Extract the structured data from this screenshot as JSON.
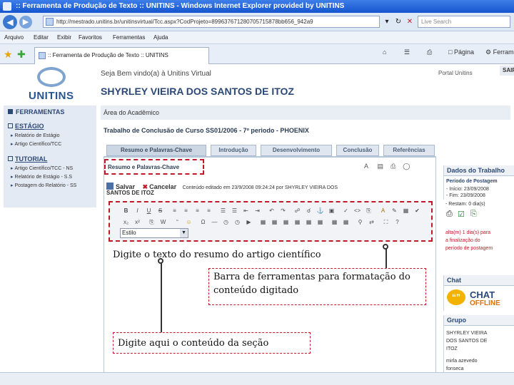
{
  "window": {
    "title": ":: Ferramenta de Produção de Texto :: UNITINS - Windows Internet Explorer provided by UNITINS"
  },
  "address": {
    "url": "http://mestrado.unitins.br/unitinsvirtual/Tcc.aspx?CodProjeto=899637671280705715878bb656_942a9",
    "search_placeholder": "Live Search"
  },
  "menu": {
    "items": [
      "Arquivo",
      "Editar",
      "Exibir",
      "Favoritos",
      "Ferramentas",
      "Ajuda"
    ]
  },
  "tab": {
    "label": ":: Ferramenta de Produção de Texto :: UNITINS"
  },
  "browser_tools": {
    "pagina": "Página",
    "ferramentas": "Ferramentas"
  },
  "header": {
    "logo_text": "UNITINS",
    "welcome": "Seja Bem vindo(a) à Unitins Virtual",
    "portal": "Portal Unitins",
    "sair": "SAIR",
    "username": "SHYRLEY VIEIRA DOS SANTOS DE ITOZ"
  },
  "sidebar": {
    "title": "FERRAMENTAS",
    "sections": [
      {
        "label": "ESTÁGIO",
        "items": [
          "Relatório de Estágio",
          "Artigo Científico/TCC"
        ]
      },
      {
        "label": "TUTORIAL",
        "items": [
          "Artigo Científico/TCC - NS",
          "Relatório de Estágio - S.S",
          "Postagem do Relatório - SS"
        ]
      }
    ]
  },
  "main": {
    "area": "Área do Acadêmico",
    "work_title": "Trabalho de Conclusão de Curso SS01/2006 - 7º periodo - PHOENIX",
    "tabs": [
      "Resumo e Palavras-Chave",
      "Introdução",
      "Desenvolvimento",
      "Conclusão",
      "Referências"
    ],
    "section_title": "Resumo e Palavras-Chave",
    "save_label": "Salvar",
    "cancel_label": "Cancelar",
    "edit_info": "Conteúdo editado em 23/9/2008 09:24:24 por SHYRLEY VIEIRA DOS",
    "edit_info_cont": "SANTOS DE ITOZ",
    "font_value": "Estilo"
  },
  "annotations": {
    "type_summary": "Digite o texto do resumo do artigo científico",
    "toolbar_note": "Barra de ferramentas para formatação do conteúdo digitado",
    "type_here": "Digite aqui o conteúdo da seção"
  },
  "right_panel": {
    "dados_head": "Dados do Trabalho",
    "periodo_head": "Período de Postagem",
    "inicio": "- Início: 23/09/2008",
    "fim": "- Fim: 23/09/2008",
    "restam": "- Restam: 0 dia(s)",
    "alert_1": "alta(m) 1 dia(s) para",
    "alert_2": "a finalização do",
    "alert_3": "período de postagem",
    "chat_head": "Chat",
    "chat_word": "CHAT",
    "chat_status": "OFFLINE",
    "grupo_head": "Grupo",
    "member_1a": "SHYRLEY VIEIRA",
    "member_1b": "DOS SANTOS DE",
    "member_1c": "ITOZ",
    "member_2a": "mirla azevedo",
    "member_2b": "fonseca"
  },
  "colors": {
    "accent": "#2b4876",
    "annotation_border": "#c01a2a",
    "titlebar": "#1555cf"
  }
}
